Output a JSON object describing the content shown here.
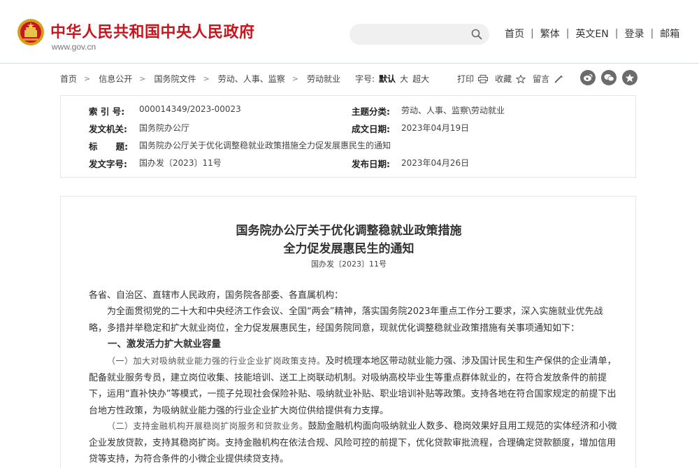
{
  "header": {
    "site_title": "中华人民共和国中央人民政府",
    "site_url": "www.gov.cn",
    "search_placeholder": "",
    "nav": [
      "首页",
      "繁体",
      "英文EN",
      "登录",
      "邮箱"
    ],
    "nav_separator": "|",
    "brand_color": "#c8161e"
  },
  "breadcrumb": {
    "items": [
      "首页",
      "信息公开",
      "国务院文件",
      "劳动、人事、监察",
      "劳动就业"
    ],
    "arrow": ">"
  },
  "tools": {
    "font_size_label": "字号:",
    "font_default": "默认",
    "font_large": "大",
    "font_xlarge": "超大",
    "print": "打印",
    "favorite": "收藏",
    "comment": "留言"
  },
  "share_icons": [
    "weibo-icon",
    "wechat-icon",
    "star-icon"
  ],
  "info": {
    "index_label": "索 引 号:",
    "index_value": "000014349/2023-00023",
    "topic_label": "主题分类:",
    "topic_value": "劳动、人事、监察\\劳动就业",
    "issuer_label": "发文机关:",
    "issuer_value": "国务院办公厅",
    "date_written_label": "成文日期:",
    "date_written_value": "2023年04月19日",
    "title_label": "标      题:",
    "title_value": "国务院办公厅关于优化调整稳就业政策措施全力促发展惠民生的通知",
    "docno_label": "发文字号:",
    "docno_value": "国办发〔2023〕11号",
    "publish_date_label": "发布日期:",
    "publish_date_value": "2023年04月26日"
  },
  "article": {
    "title_line1": "国务院办公厅关于优化调整稳就业政策措施",
    "title_line2": "全力促发展惠民生的通知",
    "doc_number": "国办发〔2023〕11号",
    "salutation": "各省、自治区、直辖市人民政府，国务院各部委、各直属机构：",
    "intro": "为全面贯彻党的二十大和中央经济工作会议、全国“两会”精神，落实国务院2023年重点工作分工要求，深入实施就业优先战略，多措并举稳定和扩大就业岗位，全力促发展惠民生，经国务院同意，现就优化调整稳就业政策措施有关事项通知如下：",
    "section1_heading": "一、激发活力扩大就业容量",
    "item1_lead": "（一）加大对吸纳就业能力强的行业企业扩岗政策支持。",
    "item1_body": "及时梳理本地区带动就业能力强、涉及国计民生和生产保供的企业清单，配备就业服务专员，建立岗位收集、技能培训、送工上岗联动机制。对吸纳高校毕业生等重点群体就业的，在符合发放条件的前提下，运用“直补快办”等模式，一揽子兑现社会保险补贴、吸纳就业补贴、职业培训补贴等政策。支持各地在符合国家规定的前提下出台地方性政策，为吸纳就业能力强的行业企业扩大岗位供给提供有力支撑。",
    "item2_lead": "（二）支持金融机构开展稳岗扩岗服务和贷款业务。",
    "item2_body": "鼓励金融机构面向吸纳就业人数多、稳岗效果好且用工规范的实体经济和小微企业发放贷款，支持其稳岗扩岗。支持金融机构在依法合规、风险可控的前提下，优化贷款审批流程，合理确定贷款额度，增加信用贷等支持，为符合条件的小微企业提供续贷支持。"
  }
}
